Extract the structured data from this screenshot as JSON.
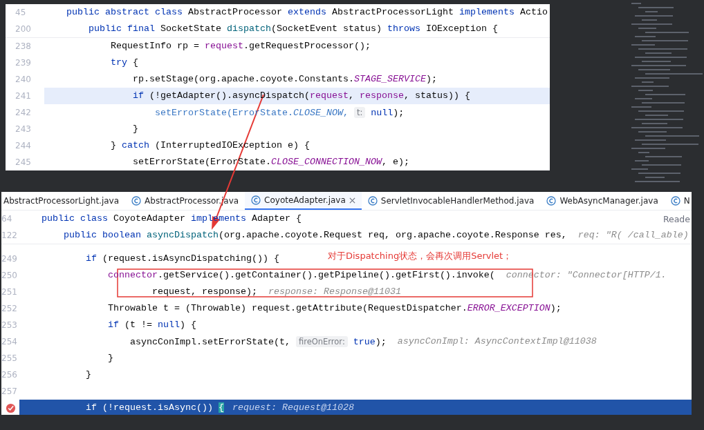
{
  "top_editor": {
    "sticky_lines": [
      {
        "number": "45",
        "tokens": [
          {
            "text": "    public abstract class",
            "kind": "keyword"
          },
          {
            "text": " AbstractProcessor ",
            "kind": "plain"
          },
          {
            "text": "extends",
            "kind": "keyword"
          },
          {
            "text": " AbstractProcessorLight ",
            "kind": "plain"
          },
          {
            "text": "implements",
            "kind": "keyword"
          },
          {
            "text": " Actio",
            "kind": "plain"
          }
        ]
      },
      {
        "number": "200",
        "tokens": [
          {
            "text": "        public final",
            "kind": "keyword"
          },
          {
            "text": " SocketState ",
            "kind": "plain"
          },
          {
            "text": "dispatch",
            "kind": "decl"
          },
          {
            "text": "(SocketEvent status) ",
            "kind": "plain"
          },
          {
            "text": "throws",
            "kind": "keyword"
          },
          {
            "text": " IOException {",
            "kind": "plain"
          }
        ]
      }
    ],
    "lines": [
      {
        "number": "238",
        "caret_line": false,
        "tokens": [
          {
            "text": "            RequestInfo rp = ",
            "kind": "plain"
          },
          {
            "text": "request",
            "kind": "field"
          },
          {
            "text": ".getRequestProcessor();",
            "kind": "plain"
          }
        ]
      },
      {
        "number": "239",
        "caret_line": false,
        "tokens": [
          {
            "text": "            try",
            "kind": "keyword"
          },
          {
            "text": " {",
            "kind": "plain"
          }
        ]
      },
      {
        "number": "240",
        "caret_line": false,
        "tokens": [
          {
            "text": "                rp.setStage(org.apache.coyote.Constants.",
            "kind": "plain"
          },
          {
            "text": "STAGE_SERVICE",
            "kind": "constant"
          },
          {
            "text": ");",
            "kind": "plain"
          }
        ]
      },
      {
        "number": "241",
        "caret_line": true,
        "tokens": [
          {
            "text": "                if",
            "kind": "keyword"
          },
          {
            "text": " (!getAdapter().asyncDispatch(",
            "kind": "plain"
          },
          {
            "text": "request",
            "kind": "field"
          },
          {
            "text": ", ",
            "kind": "plain"
          },
          {
            "text": "response",
            "kind": "field"
          },
          {
            "text": ", status)) {",
            "kind": "plain"
          }
        ]
      },
      {
        "number": "242",
        "caret_line": false,
        "tokens": [
          {
            "text": "                    setErrorState(ErrorState.",
            "kind": "dim"
          },
          {
            "text": "CLOSE_NOW",
            "kind": "dim_constant"
          },
          {
            "text": ", ",
            "kind": "dim"
          },
          {
            "text": "t:",
            "kind": "param"
          },
          {
            "text": " null",
            "kind": "keyword"
          },
          {
            "text": ");",
            "kind": "plain"
          }
        ]
      },
      {
        "number": "243",
        "caret_line": false,
        "tokens": [
          {
            "text": "                }",
            "kind": "plain"
          }
        ]
      },
      {
        "number": "244",
        "caret_line": false,
        "tokens": [
          {
            "text": "            } ",
            "kind": "plain"
          },
          {
            "text": "catch",
            "kind": "keyword"
          },
          {
            "text": " (InterruptedIOException e) {",
            "kind": "plain"
          }
        ]
      },
      {
        "number": "245",
        "caret_line": false,
        "tokens": [
          {
            "text": "                setErrorState(ErrorState.",
            "kind": "plain"
          },
          {
            "text": "CLOSE_CONNECTION_NOW",
            "kind": "constant"
          },
          {
            "text": ", e);",
            "kind": "plain"
          }
        ]
      }
    ]
  },
  "bottom_editor": {
    "tabs": [
      {
        "label": "AbstractProcessorLight.java",
        "selected": false,
        "icon": false
      },
      {
        "label": "AbstractProcessor.java",
        "selected": false,
        "icon": true
      },
      {
        "label": "CoyoteAdapter.java",
        "selected": true,
        "icon": true
      },
      {
        "label": "ServletInvocableHandlerMethod.java",
        "selected": false,
        "icon": true
      },
      {
        "label": "WebAsyncManager.java",
        "selected": false,
        "icon": true
      },
      {
        "label": "N",
        "selected": false,
        "icon": true
      }
    ],
    "sticky_lines": [
      {
        "number": "64",
        "aside": "Reade",
        "tokens": [
          {
            "text": "    public class",
            "kind": "keyword"
          },
          {
            "text": " CoyoteAdapter ",
            "kind": "plain"
          },
          {
            "text": "implements",
            "kind": "keyword"
          },
          {
            "text": " Adapter {",
            "kind": "plain"
          }
        ]
      },
      {
        "number": "122",
        "hint": "req: \"R( /call_able)",
        "tokens": [
          {
            "text": "        public boolean",
            "kind": "keyword"
          },
          {
            "text": " asyncDispatch",
            "kind": "decl"
          },
          {
            "text": "(org.apache.coyote.Request req, org.apache.coyote.Response res,",
            "kind": "plain"
          }
        ]
      }
    ],
    "lines": [
      {
        "number": "249",
        "execution_point": false,
        "breakpoint": false,
        "tokens": [
          {
            "text": "            if",
            "kind": "keyword"
          },
          {
            "text": " (request.isAsyncDispatching()) {",
            "kind": "plain"
          }
        ]
      },
      {
        "number": "250",
        "execution_point": false,
        "breakpoint": false,
        "hint": "connector: \"Connector[HTTP/1.",
        "tokens": [
          {
            "text": "                connector",
            "kind": "field"
          },
          {
            "text": ".getService().getContainer().getPipeline().getFirst().invoke(",
            "kind": "plain"
          }
        ]
      },
      {
        "number": "251",
        "execution_point": false,
        "breakpoint": false,
        "hint": "response: Response@11031",
        "tokens": [
          {
            "text": "                        request, response);",
            "kind": "plain"
          }
        ]
      },
      {
        "number": "252",
        "execution_point": false,
        "breakpoint": false,
        "tokens": [
          {
            "text": "                Throwable t = (Throwable) request.getAttribute(RequestDispatcher.",
            "kind": "plain"
          },
          {
            "text": "ERROR_EXCEPTION",
            "kind": "constant"
          },
          {
            "text": ");",
            "kind": "plain"
          }
        ]
      },
      {
        "number": "253",
        "execution_point": false,
        "breakpoint": false,
        "tokens": [
          {
            "text": "                if",
            "kind": "keyword"
          },
          {
            "text": " (t != ",
            "kind": "plain"
          },
          {
            "text": "null",
            "kind": "keyword"
          },
          {
            "text": ") {",
            "kind": "plain"
          }
        ]
      },
      {
        "number": "254",
        "execution_point": false,
        "breakpoint": false,
        "hint": "asyncConImpl: AsyncContextImpl@11038",
        "tokens": [
          {
            "text": "                    asyncConImpl.setErrorState(t, ",
            "kind": "plain"
          },
          {
            "text": "fireOnError:",
            "kind": "param"
          },
          {
            "text": " true",
            "kind": "keyword"
          },
          {
            "text": ");",
            "kind": "plain"
          }
        ]
      },
      {
        "number": "255",
        "execution_point": false,
        "breakpoint": false,
        "tokens": [
          {
            "text": "                }",
            "kind": "plain"
          }
        ]
      },
      {
        "number": "256",
        "execution_point": false,
        "breakpoint": false,
        "tokens": [
          {
            "text": "            }",
            "kind": "plain"
          }
        ]
      },
      {
        "number": "257",
        "execution_point": false,
        "breakpoint": false
      },
      {
        "execution_point": true,
        "breakpoint": true,
        "hint": "request: Request@11028",
        "tokens": [
          {
            "text": "            if",
            "kind": "keyword"
          },
          {
            "text": " (!request.isAsync()) ",
            "kind": "plain"
          },
          {
            "text": "{",
            "kind": "brace"
          }
        ]
      }
    ]
  },
  "annotation": {
    "note": "对于Dispatching状态，会再次调用Servlet；"
  }
}
